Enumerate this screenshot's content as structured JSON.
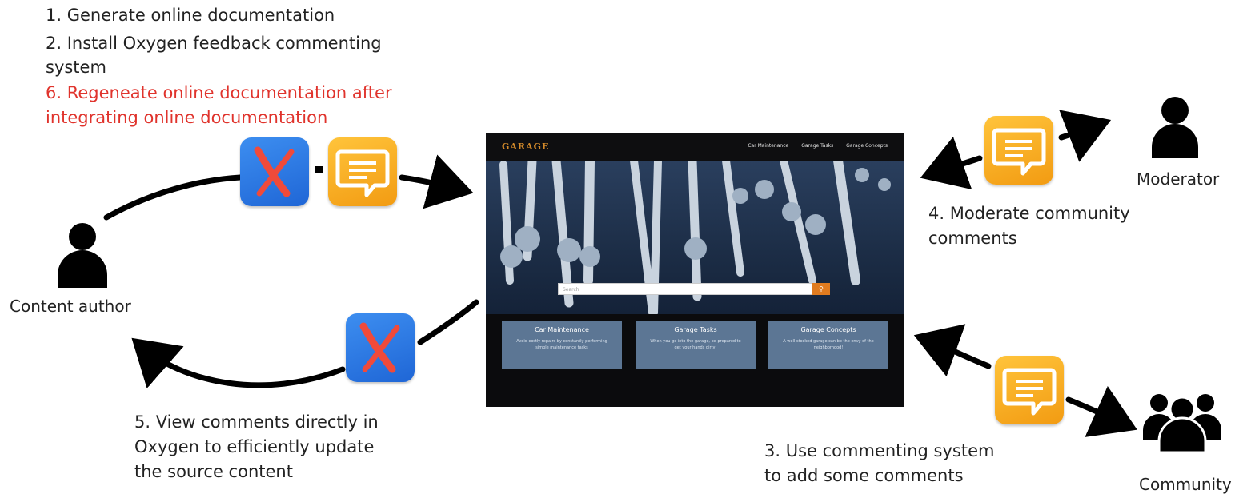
{
  "steps": {
    "s1": "1. Generate online documentation",
    "s2_line1": "2. Install Oxygen feedback commenting",
    "s2_line2": "system",
    "s6_line1": "6. Regeneate online documentation after",
    "s6_line2": "integrating online documentation",
    "s4_line1": "4. Moderate community",
    "s4_line2": "comments",
    "s5_line1": "5. View comments directly in",
    "s5_line2": "Oxygen to efficiently update",
    "s5_line3": "the source content",
    "s3_line1": "3. Use commenting system",
    "s3_line2": "to add some comments"
  },
  "roles": {
    "author": "Content author",
    "moderator": "Moderator",
    "community": "Community"
  },
  "icons": {
    "oxygen": "oxygen-x-icon",
    "feedback": "feedback-chat-icon",
    "person": "person-icon",
    "group": "people-group-icon"
  },
  "colors": {
    "highlight": "#e0332c",
    "oxygen_blue": "#1f66d6",
    "feedback_orange": "#f29b12",
    "site_accent": "#e07b1f"
  },
  "site": {
    "logo": "GARAGE",
    "nav": [
      "Car Maintenance",
      "Garage Tasks",
      "Garage Concepts"
    ],
    "search_placeholder": "Search",
    "cards": [
      {
        "title": "Car Maintenance",
        "desc": "Avoid costly repairs by constantly performing simple maintenance tasks"
      },
      {
        "title": "Garage Tasks",
        "desc": "When you go into the garage, be prepared to get your hands dirty!"
      },
      {
        "title": "Garage Concepts",
        "desc": "A well-stocked garage can be the envy of the neighborhood!"
      }
    ]
  }
}
